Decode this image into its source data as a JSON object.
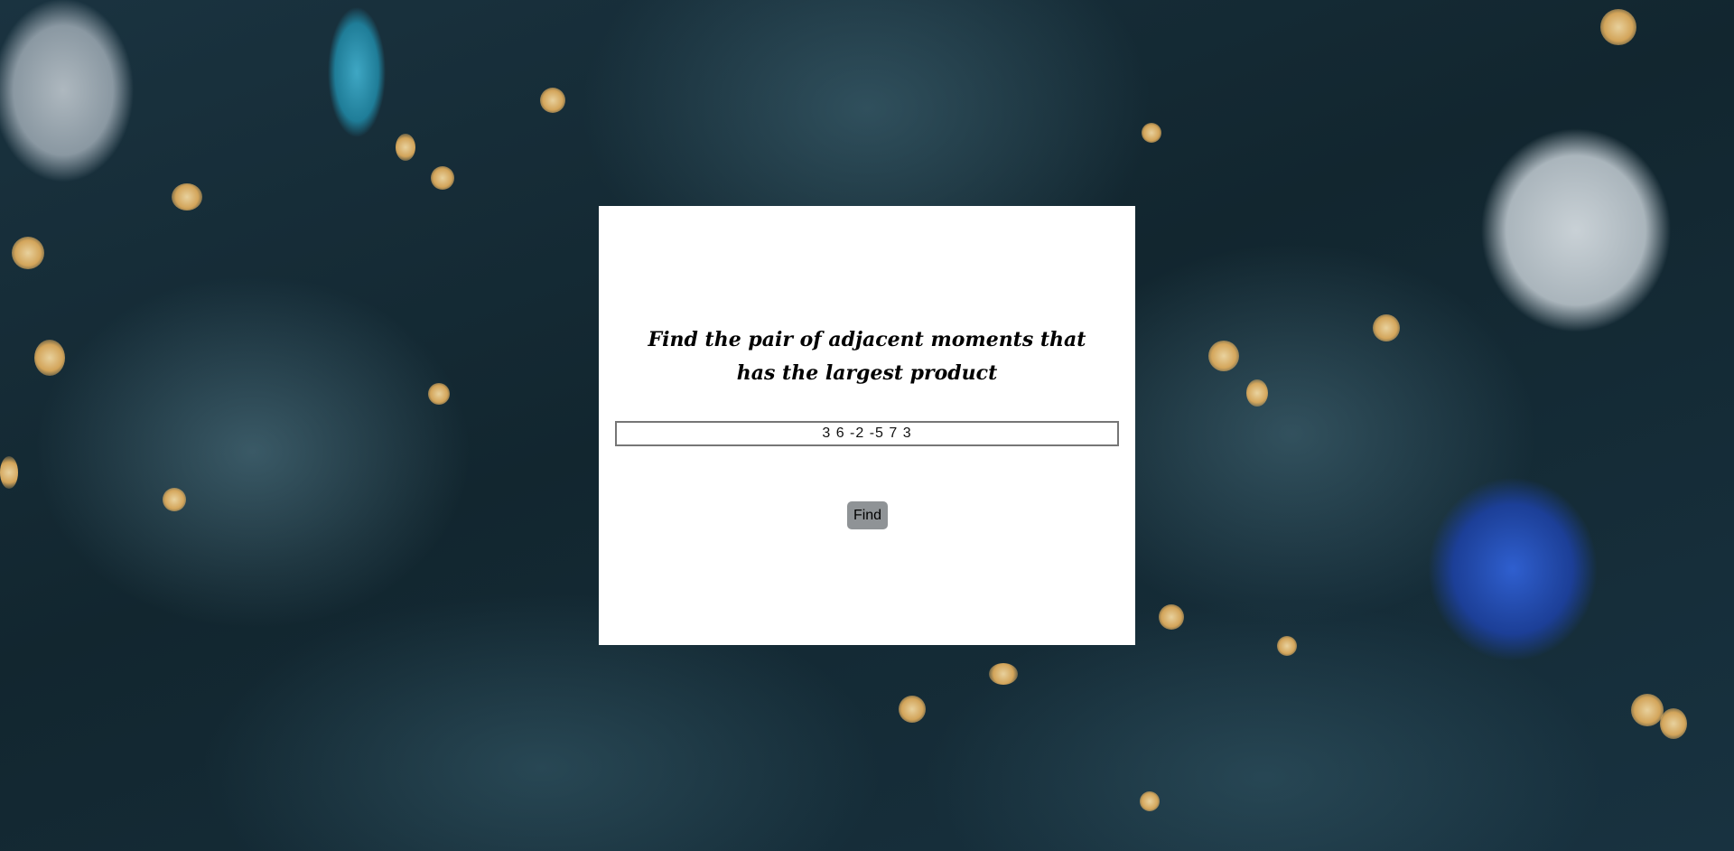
{
  "dialog": {
    "title": "Find the pair of adjacent moments that has the largest product",
    "input_value": "3 6 -2 -5 7 3",
    "input_placeholder": "",
    "find_button_label": "Find"
  },
  "colors": {
    "card_background": "#ffffff",
    "button_background": "#8f9396",
    "input_border": "#767676"
  }
}
